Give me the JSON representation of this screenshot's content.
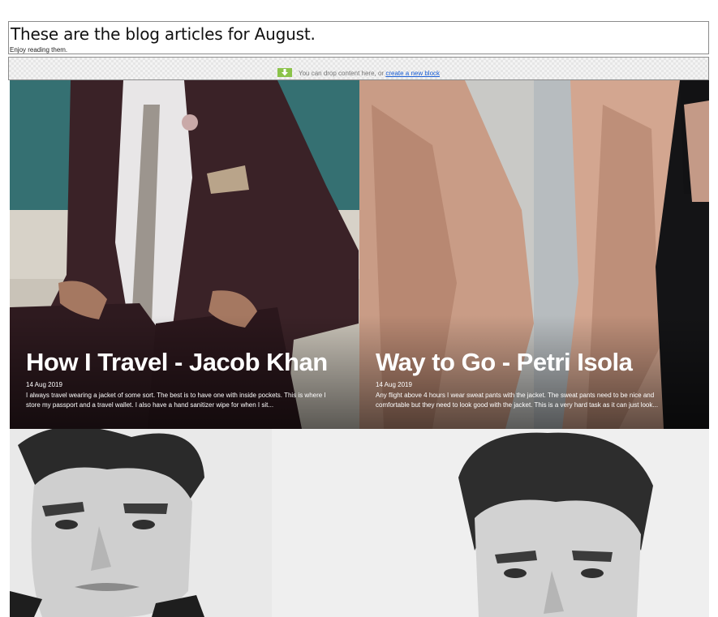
{
  "header": {
    "title": "These are the blog articles for August.",
    "subtitle": "Enjoy reading them."
  },
  "drop_zone": {
    "text": "You can drop content here, or",
    "link_label": "create a new block",
    "icon": "download-arrow-icon",
    "icon_color": "#8bc34a",
    "link_color": "#1a5fd6"
  },
  "articles": [
    {
      "title": "How I Travel - Jacob Khan",
      "date": "14 Aug 2019",
      "excerpt": "I always travel wearing a jacket of some sort. The best is to have one with inside pockets. This is where I store my passport and a travel wallet. I also have a hand sanitizer wipe for when I sit...",
      "image": "photo-man-in-burgundy-suit"
    },
    {
      "title": "Way to Go - Petri Isola",
      "date": "14 Aug 2019",
      "excerpt": "Any flight above 4 hours I wear sweat pants with the jacket. The sweat pants need to be nice and comfortable but they need to look good with the jacket. This is a very hard task as it can just look...",
      "image": "photo-beige-trench-coat"
    },
    {
      "image": "photo-black-white-portrait-man"
    },
    {
      "image": "photo-black-white-portrait-man-tousled-hair"
    }
  ]
}
